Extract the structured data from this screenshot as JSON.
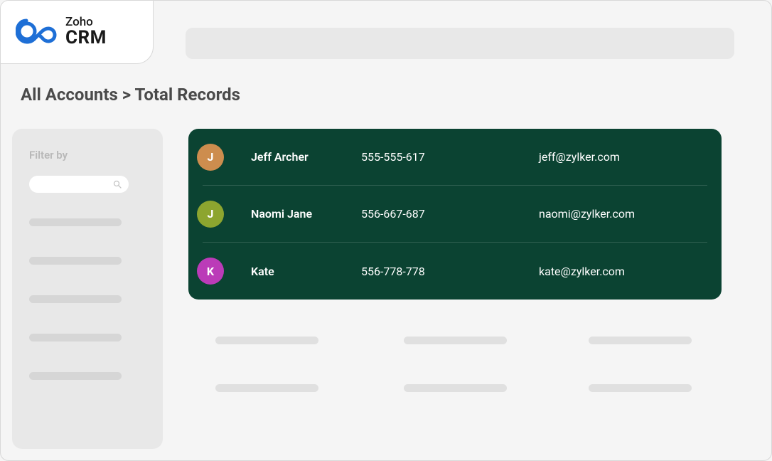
{
  "brand": {
    "company": "Zoho",
    "product": "CRM"
  },
  "breadcrumb": "All Accounts > Total Records",
  "sidebar": {
    "filter_label": "Filter by"
  },
  "records": [
    {
      "initial": "J",
      "avatar_color": "#cd8d4e",
      "name": "Jeff Archer",
      "phone": "555-555-617",
      "email": "jeff@zylker.com"
    },
    {
      "initial": "J",
      "avatar_color": "#8da52f",
      "name": "Naomi Jane",
      "phone": "556-667-687",
      "email": "naomi@zylker.com"
    },
    {
      "initial": "K",
      "avatar_color": "#bb3bb8",
      "name": "Kate",
      "phone": "556-778-778",
      "email": "kate@zylker.com"
    }
  ]
}
